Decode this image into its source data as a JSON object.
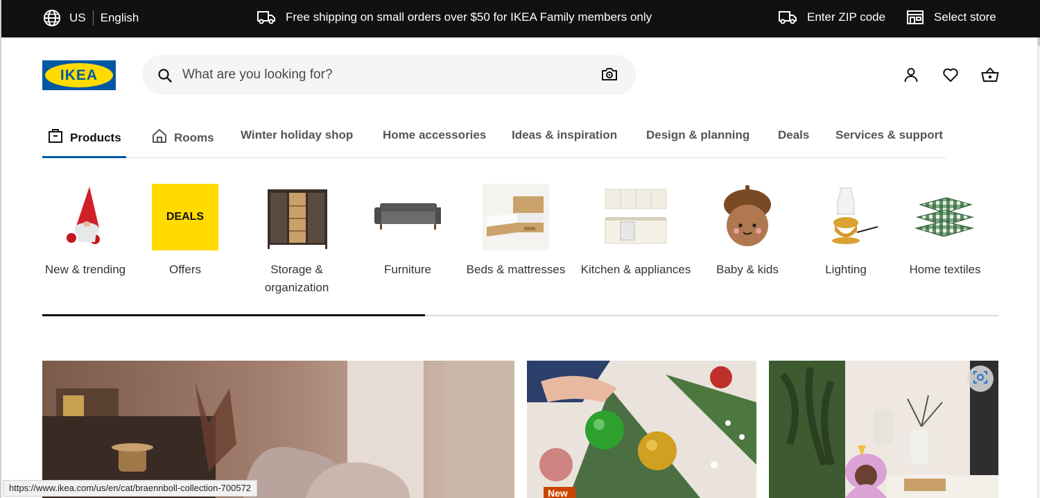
{
  "topbar": {
    "country": "US",
    "language": "English",
    "promo": "Free shipping on small orders over $50 for IKEA Family members only",
    "zip": "Enter ZIP code",
    "store": "Select store",
    "icons": [
      "globe-icon",
      "truck-icon",
      "truck-icon",
      "store-icon"
    ]
  },
  "header": {
    "logo_text": "IKEA",
    "search_placeholder": "What are you looking for?",
    "icons": [
      "search-icon",
      "camera-icon",
      "profile-icon",
      "heart-icon",
      "basket-icon"
    ]
  },
  "nav": {
    "tabs": [
      {
        "label": "Products",
        "icon": "box-icon",
        "active": true
      },
      {
        "label": "Rooms",
        "icon": "house-icon"
      },
      {
        "label": "Winter holiday shop"
      },
      {
        "label": "Home accessories"
      },
      {
        "label": "Ideas & inspiration"
      },
      {
        "label": "Design & planning"
      },
      {
        "label": "Deals"
      },
      {
        "label": "Services & support"
      }
    ]
  },
  "categories": [
    {
      "label": "New & trending"
    },
    {
      "label": "Offers",
      "badge": "DEALS"
    },
    {
      "label": "Storage & organization"
    },
    {
      "label": "Furniture"
    },
    {
      "label": "Beds & mattresses"
    },
    {
      "label": "Kitchen & appliances"
    },
    {
      "label": "Baby & kids"
    },
    {
      "label": "Lighting"
    },
    {
      "label": "Home textiles"
    }
  ],
  "carousel_progress": 0.4,
  "hero": {
    "new_badge": "New"
  },
  "status_url": "https://www.ikea.com/us/en/cat/braennboll-collection-700572",
  "colors": {
    "topbar_bg": "#111111",
    "brand_blue": "#0058a3",
    "brand_yellow": "#ffdb00",
    "search_bg": "#f5f5f5"
  }
}
